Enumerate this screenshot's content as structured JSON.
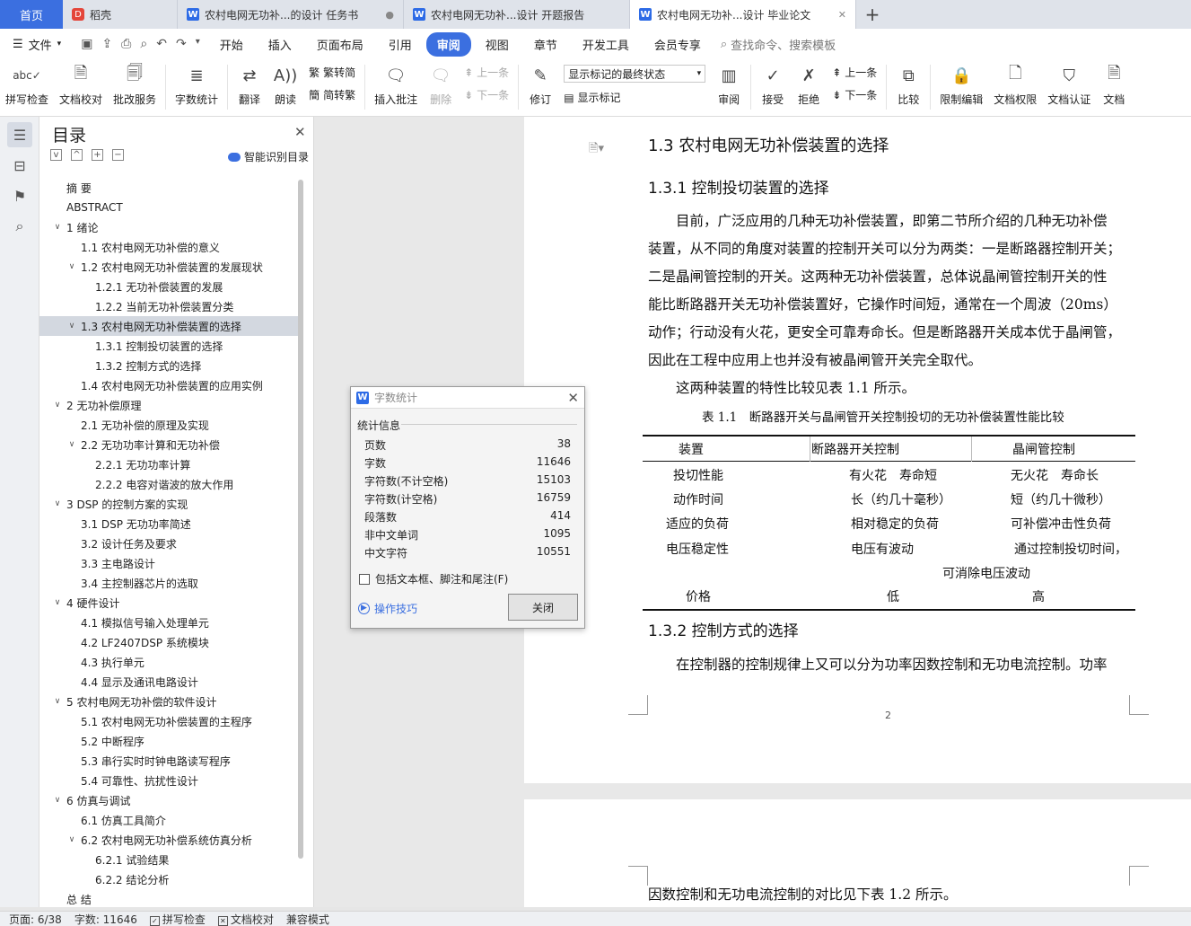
{
  "tabs": {
    "home": "首页",
    "daoke": "稻壳",
    "docs": [
      {
        "title": "农村电网无功补...的设计 任务书"
      },
      {
        "title": "农村电网无功补...设计 开题报告"
      },
      {
        "title": "农村电网无功补...设计 毕业论文"
      }
    ],
    "add": "+"
  },
  "menu": {
    "file": "文件",
    "items": [
      "开始",
      "插入",
      "页面布局",
      "引用",
      "审阅",
      "视图",
      "章节",
      "开发工具",
      "会员专享"
    ],
    "active": "审阅",
    "search": "查找命令、搜索模板"
  },
  "ribbon": {
    "spell": "拼写检查",
    "proof": "文档校对",
    "batch": "批改服务",
    "wordcount": "字数统计",
    "translate": "翻译",
    "read": "朗读",
    "trad2simp": "繁转简",
    "simp2trad": "简转繁",
    "insert_comment": "插入批注",
    "delete": "删除",
    "prev": "上一条",
    "next": "下一条",
    "track": "修订",
    "markup_select": "显示标记的最终状态",
    "show_markup": "显示标记",
    "review": "审阅",
    "accept": "接受",
    "reject": "拒绝",
    "prev2": "上一条",
    "next2": "下一条",
    "compare": "比较",
    "restrict": "限制编辑",
    "permission": "文档权限",
    "certify": "文档认证",
    "doc_more": "文档"
  },
  "toc": {
    "title": "目录",
    "smart": "智能识别目录",
    "items": [
      {
        "text": "摘  要",
        "level": 0,
        "caret": ""
      },
      {
        "text": "ABSTRACT",
        "level": 0,
        "caret": ""
      },
      {
        "text": "1 绪论",
        "level": 0,
        "caret": "v"
      },
      {
        "text": "1.1 农村电网无功补偿的意义",
        "level": 1,
        "caret": ""
      },
      {
        "text": "1.2 农村电网无功补偿装置的发展现状",
        "level": 1,
        "caret": "v"
      },
      {
        "text": "1.2.1 无功补偿装置的发展",
        "level": 2,
        "caret": ""
      },
      {
        "text": "1.2.2 当前无功补偿装置分类",
        "level": 2,
        "caret": ""
      },
      {
        "text": "1.3 农村电网无功补偿装置的选择",
        "level": 1,
        "caret": "v",
        "selected": true
      },
      {
        "text": "1.3.1 控制投切装置的选择",
        "level": 2,
        "caret": ""
      },
      {
        "text": "1.3.2 控制方式的选择",
        "level": 2,
        "caret": ""
      },
      {
        "text": "1.4 农村电网无功补偿装置的应用实例",
        "level": 1,
        "caret": ""
      },
      {
        "text": "2  无功补偿原理",
        "level": 0,
        "caret": "v"
      },
      {
        "text": "2.1 无功补偿的原理及实现",
        "level": 1,
        "caret": ""
      },
      {
        "text": "2.2 无功功率计算和无功补偿",
        "level": 1,
        "caret": "v"
      },
      {
        "text": "2.2.1 无功功率计算",
        "level": 2,
        "caret": ""
      },
      {
        "text": "2.2.2 电容对谐波的放大作用",
        "level": 2,
        "caret": ""
      },
      {
        "text": "3 DSP 的控制方案的实现",
        "level": 0,
        "caret": "v"
      },
      {
        "text": "3.1 DSP 无功功率简述",
        "level": 1,
        "caret": ""
      },
      {
        "text": "3.2 设计任务及要求",
        "level": 1,
        "caret": ""
      },
      {
        "text": "3.3 主电路设计",
        "level": 1,
        "caret": ""
      },
      {
        "text": "3.4 主控制器芯片的选取",
        "level": 1,
        "caret": ""
      },
      {
        "text": "4 硬件设计",
        "level": 0,
        "caret": "v"
      },
      {
        "text": "4.1 模拟信号输入处理单元",
        "level": 1,
        "caret": ""
      },
      {
        "text": "4.2 LF2407DSP 系统模块",
        "level": 1,
        "caret": ""
      },
      {
        "text": "4.3 执行单元",
        "level": 1,
        "caret": ""
      },
      {
        "text": "4.4 显示及通讯电路设计",
        "level": 1,
        "caret": ""
      },
      {
        "text": "5 农村电网无功补偿的软件设计",
        "level": 0,
        "caret": "v"
      },
      {
        "text": "5.1 农村电网无功补偿装置的主程序",
        "level": 1,
        "caret": ""
      },
      {
        "text": "5.2 中断程序",
        "level": 1,
        "caret": ""
      },
      {
        "text": "5.3 串行实时时钟电路读写程序",
        "level": 1,
        "caret": ""
      },
      {
        "text": "5.4 可靠性、抗扰性设计",
        "level": 1,
        "caret": ""
      },
      {
        "text": "6 仿真与调试",
        "level": 0,
        "caret": "v"
      },
      {
        "text": "6.1 仿真工具简介",
        "level": 1,
        "caret": ""
      },
      {
        "text": "6.2 农村电网无功补偿系统仿真分析",
        "level": 1,
        "caret": "v"
      },
      {
        "text": "6.2.1 试验结果",
        "level": 2,
        "caret": ""
      },
      {
        "text": "6.2.2 结论分析",
        "level": 2,
        "caret": ""
      },
      {
        "text": "总  结",
        "level": 0,
        "caret": ""
      }
    ]
  },
  "doc": {
    "h_1_3": "1.3 农村电网无功补偿装置的选择",
    "h_1_3_1": "1.3.1 控制投切装置的选择",
    "para1": [
      "　　目前，广泛应用的几种无功补偿装置，即第二节所介绍的几种无功补偿",
      "装置，从不同的角度对装置的控制开关可以分为两类：一是断路器控制开关；",
      "二是晶闸管控制的开关。这两种无功补偿装置，总体说晶闸管控制开关的性",
      "能比断路器开关无功补偿装置好，它操作时间短，通常在一个周波（20ms）",
      "动作；行动没有火花，更安全可靠寿命长。但是断路器开关成本优于晶闸管，",
      "因此在工程中应用上也并没有被晶闸管开关完全取代。"
    ],
    "para2": "　　这两种装置的特性比较见表 1.1 所示。",
    "table_caption": "表 1.1　断路器开关与晶闸管开关控制投切的无功补偿装置性能比较",
    "table": {
      "headers": [
        "装置",
        "断路器开关控制",
        "晶闸管控制"
      ],
      "rows": [
        [
          "投切性能",
          "有火花　寿命短",
          "无火花　寿命长"
        ],
        [
          "动作时间",
          "长（约几十毫秒）",
          "短（约几十微秒）"
        ],
        [
          "适应的负荷",
          "相对稳定的负荷",
          "可补偿冲击性负荷"
        ],
        [
          "电压稳定性",
          "电压有波动",
          "通过控制投切时间，"
        ],
        [
          "",
          "",
          "可消除电压波动"
        ],
        [
          "价格",
          "低",
          "高"
        ]
      ]
    },
    "h_1_3_2": "1.3.2 控制方式的选择",
    "para3": "　　在控制器的控制规律上又可以分为功率因数控制和无功电流控制。功率",
    "page_number": "2",
    "page2_text": "因数控制和无功电流控制的对比见下表 1.2 所示。"
  },
  "dialog": {
    "title": "字数统计",
    "section": "统计信息",
    "stats": [
      {
        "label": "页数",
        "value": "38"
      },
      {
        "label": "字数",
        "value": "11646"
      },
      {
        "label": "字符数(不计空格)",
        "value": "15103"
      },
      {
        "label": "字符数(计空格)",
        "value": "16759"
      },
      {
        "label": "段落数",
        "value": "414"
      },
      {
        "label": "非中文单词",
        "value": "1095"
      },
      {
        "label": "中文字符",
        "value": "10551"
      }
    ],
    "checkbox": "包括文本框、脚注和尾注(F)",
    "tips": "操作技巧",
    "close": "关闭"
  },
  "status": {
    "page": "页面: 6/38",
    "words": "字数: 11646",
    "spell": "拼写检查",
    "proof": "文档校对",
    "compat": "兼容模式"
  }
}
